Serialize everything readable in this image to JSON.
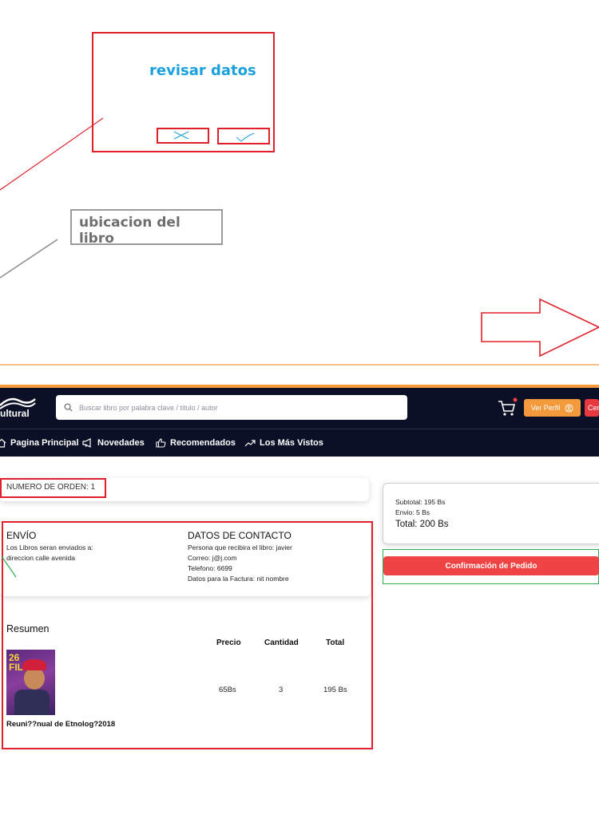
{
  "annotations": {
    "review_title": "revisar datos",
    "book_location_label": "ubicacion del libro"
  },
  "header": {
    "logo_text": "ultural",
    "search_placeholder": "Buscar libro por palabra clave / titulo / autor",
    "profile_button": "Ver Perfil",
    "logout_button_partial": "Cer"
  },
  "nav": {
    "items": [
      {
        "label": "Pagina Principal",
        "icon": "home-icon"
      },
      {
        "label": "Novedades",
        "icon": "megaphone-icon"
      },
      {
        "label": "Recomendados",
        "icon": "thumbs-up-icon"
      },
      {
        "label": "Los Más Vistos",
        "icon": "trending-icon"
      }
    ]
  },
  "order": {
    "number_label": "NUMERO DE ORDEN:",
    "number_value": "1"
  },
  "shipping": {
    "title": "ENVÍO",
    "line1": "Los Libros seran enviados a:",
    "line2": "direccion calle avenida"
  },
  "contact": {
    "title": "DATOS DE CONTACTO",
    "receiver": "Persona que recibira el libro: javier",
    "email": "Correo: j@j.com",
    "phone": "Telefono: 6699",
    "invoice": "Datos para la Factura: nit nombre"
  },
  "summary": {
    "title": "Resumen",
    "columns": [
      "Precio",
      "Cantidad",
      "Total"
    ],
    "item": {
      "title": "Reuni??nual de Etnolog?2018",
      "price": "65Bs",
      "quantity": "3",
      "total": "195 Bs",
      "cover_text": "26 FIL"
    }
  },
  "totals": {
    "subtotal": "Subtotal: 195 Bs",
    "shipping": "Envio: 5 Bs",
    "total": "Total: 200 Bs"
  },
  "confirm_button": "Confirmación de Pedido",
  "colors": {
    "navy": "#0b1026",
    "orange": "#f39a3d",
    "red": "#ef4444",
    "annotation_red": "#e0202a",
    "annotation_green": "#2bb24c",
    "annotation_blue": "#1aa0dc"
  }
}
